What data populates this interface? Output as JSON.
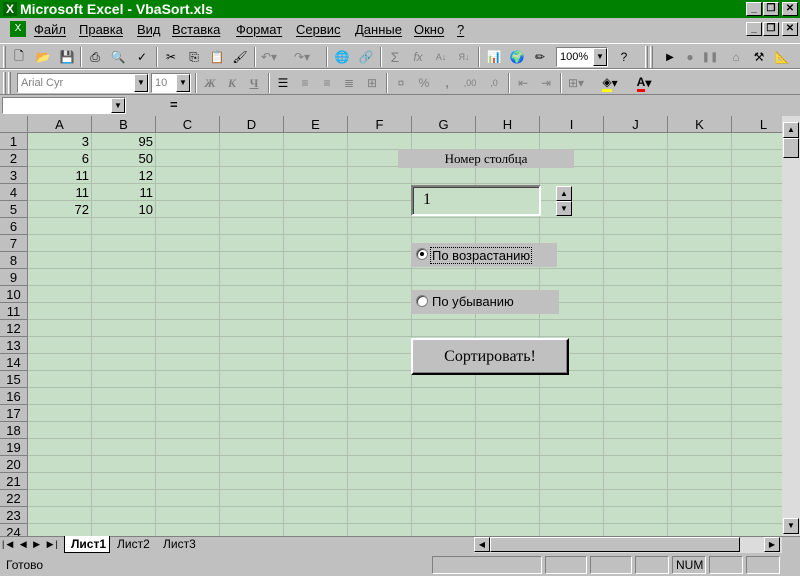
{
  "window": {
    "title": "Microsoft Excel - VbaSort.xls"
  },
  "menu": [
    {
      "label": "Файл"
    },
    {
      "label": "Правка"
    },
    {
      "label": "Вид"
    },
    {
      "label": "Вставка"
    },
    {
      "label": "Формат"
    },
    {
      "label": "Сервис"
    },
    {
      "label": "Данные"
    },
    {
      "label": "Окно"
    },
    {
      "label": "?"
    }
  ],
  "toolbar": {
    "zoom": "100%",
    "sum_symbol": "Σ",
    "fx_label": "fx"
  },
  "format_toolbar": {
    "font_name": "Arial Cyr",
    "font_size": "10",
    "bold": "Ж",
    "italic": "К",
    "underline": "Ч",
    "percent": "%",
    "comma": ",",
    "inc_decimal": ",00",
    "dec_decimal": ",0"
  },
  "formula_bar": {
    "name_box": "",
    "equals": "=",
    "content": ""
  },
  "columns": [
    "A",
    "B",
    "C",
    "D",
    "E",
    "F",
    "G",
    "H",
    "I",
    "J",
    "K",
    "L"
  ],
  "rows": [
    "1",
    "2",
    "3",
    "4",
    "5",
    "6",
    "7",
    "8",
    "9",
    "10",
    "11",
    "12",
    "13",
    "14",
    "15",
    "16",
    "17",
    "18",
    "19",
    "20",
    "21",
    "22",
    "23",
    "24"
  ],
  "cells": {
    "A": [
      "3",
      "6",
      "11",
      "11",
      "72"
    ],
    "B": [
      "95",
      "50",
      "12",
      "11",
      "10"
    ]
  },
  "form": {
    "column_label": "Номер столбца",
    "column_value": "1",
    "option_ascending": "По возрастанию",
    "option_descending": "По убыванию",
    "ascending_selected": true,
    "sort_button": "Сортировать!"
  },
  "sheets": [
    {
      "label": "Лист1",
      "active": true
    },
    {
      "label": "Лист2",
      "active": false
    },
    {
      "label": "Лист3",
      "active": false
    }
  ],
  "status": {
    "ready": "Готово",
    "num": "NUM"
  },
  "colors": {
    "title_bg": "#008000",
    "grid_bg": "#c7dfc7",
    "chrome": "#c0c0c0"
  }
}
